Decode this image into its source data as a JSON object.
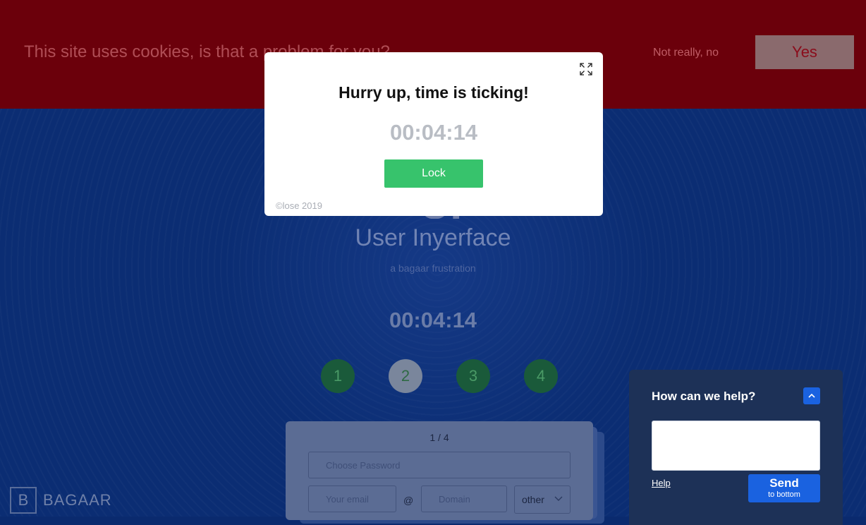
{
  "cookie_banner": {
    "text": "This site uses cookies, is that a problem for you?",
    "decline_label": "Not really, no",
    "accept_label": "Yes"
  },
  "app": {
    "logo_fragment": "UI",
    "title": "User Inyerface",
    "subtitle": "a bagaar frustration",
    "timer": "00:04:14"
  },
  "steps": [
    "1",
    "2",
    "3",
    "4"
  ],
  "active_step": "2",
  "form": {
    "page_count": "1 / 4",
    "password_placeholder": "Choose Password",
    "email_placeholder": "Your email",
    "at_sign": "@",
    "domain_placeholder": "Domain",
    "tld_value": "other"
  },
  "brand": {
    "box_letter": "B",
    "name": "BAGAAR"
  },
  "help_widget": {
    "title": "How can we help?",
    "help_link": "Help",
    "send_label": "Send",
    "send_sublabel": "to bottom"
  },
  "modal": {
    "title": "Hurry up, time is ticking!",
    "timer": "00:04:14",
    "lock_label": "Lock",
    "footer": "©lose 2019"
  },
  "colors": {
    "cookie_bar": "#6b000b",
    "page_background": "#0b2d73",
    "lock_button": "#37c36c",
    "send_button": "#1a62e0"
  }
}
